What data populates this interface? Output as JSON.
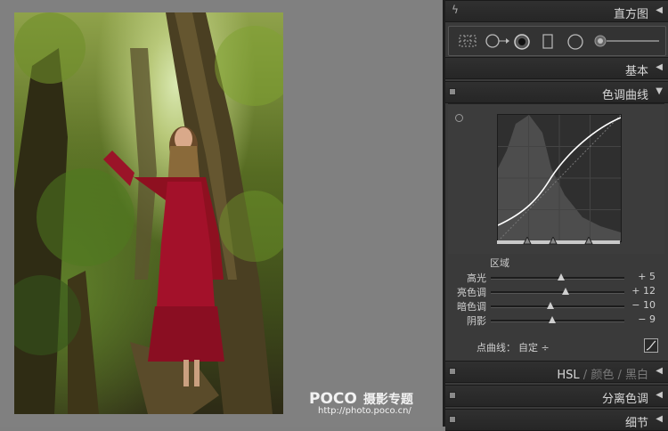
{
  "panel": {
    "histogram": {
      "title": "直方图"
    },
    "basic": {
      "title": "基本"
    },
    "tone_curve": {
      "title": "色调曲线",
      "region_label": "区域",
      "sliders": [
        {
          "label": "高光",
          "value": "+ 5",
          "position": 0.53
        },
        {
          "label": "亮色调",
          "value": "+ 12",
          "position": 0.56
        },
        {
          "label": "暗色调",
          "value": "− 10",
          "position": 0.45
        },
        {
          "label": "阴影",
          "value": "− 9",
          "position": 0.46
        }
      ],
      "point_curve_label": "点曲线：",
      "point_curve_value": "自定 ÷"
    },
    "hsl": {
      "part1": "HSL",
      "sep1": " / ",
      "part2": "颜色",
      "sep2": " / ",
      "part3": "黑白"
    },
    "split_toning": {
      "title": "分离色调"
    },
    "detail": {
      "title": "细节"
    }
  },
  "watermark": {
    "logo": "POCO",
    "brand": "摄影专题",
    "url": "http://photo.poco.cn/"
  },
  "icons": [
    "grid-icon",
    "circle-crop-icon",
    "spot-removal-icon",
    "graduated-filter-icon",
    "radial-filter-icon",
    "brush-icon"
  ],
  "colors": {
    "panel_bg": "#3a3a3a",
    "header_bg": "#282828",
    "canvas_bg": "#808080"
  }
}
